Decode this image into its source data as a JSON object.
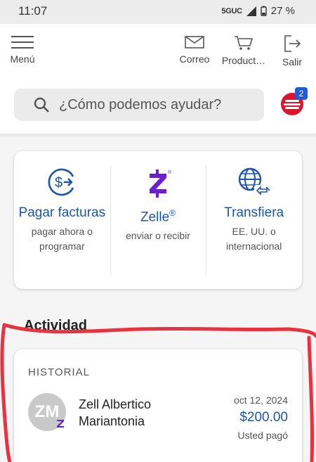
{
  "status_bar": {
    "time": "11:07",
    "network": "5GUC",
    "battery": "27 %"
  },
  "header": {
    "nav": {
      "menu_label": "Menú",
      "mail_label": "Correo",
      "products_label": "Product…",
      "exit_label": "Salir"
    },
    "search": {
      "placeholder": "¿Cómo podemos ayudar?"
    },
    "chat_badge": "2"
  },
  "actions": [
    {
      "title": "Pagar facturas",
      "subtitle": "pagar ahora o programar",
      "icon": "dollar-transfer-icon"
    },
    {
      "title": "Zelle",
      "trademark": "®",
      "subtitle": "enviar o recibir",
      "icon": "zelle-icon"
    },
    {
      "title": "Transfiera",
      "subtitle": "EE. UU. o internacional",
      "icon": "globe-transfer-icon"
    }
  ],
  "activity": {
    "label": "Actividad"
  },
  "history": {
    "title": "HISTORIAL",
    "items": [
      {
        "initials": "ZM",
        "name": "Zell Albertico Mariantonia",
        "date": "oct 12, 2024",
        "amount": "$200.00",
        "status": "Usted pagó"
      }
    ]
  },
  "colors": {
    "accent_blue": "#1c54b2",
    "zelle_purple": "#6d1ed4",
    "badge_blue": "#1e5bd8",
    "brand_red": "#e3122c",
    "annotation_red": "#e8323f"
  }
}
